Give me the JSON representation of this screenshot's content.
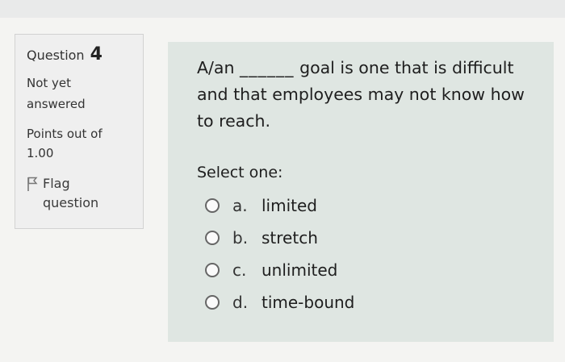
{
  "question_info": {
    "label": "Question",
    "number": "4",
    "state": "Not yet answered",
    "grade": "Points out of 1.00",
    "flag_label": "Flag question",
    "flag_icon": "flag-icon"
  },
  "question": {
    "text_before": "A/an",
    "blank": "______",
    "text_after": "goal is one that is difficult and that employees may not know how to reach."
  },
  "prompt": "Select one:",
  "options": [
    {
      "letter": "a.",
      "label": "limited"
    },
    {
      "letter": "b.",
      "label": "stretch"
    },
    {
      "letter": "c.",
      "label": "unlimited"
    },
    {
      "letter": "d.",
      "label": "time-bound"
    }
  ],
  "colors": {
    "content_background": "#dfe6e2",
    "info_background": "#efefef",
    "page_background": "#f4f4f2"
  }
}
